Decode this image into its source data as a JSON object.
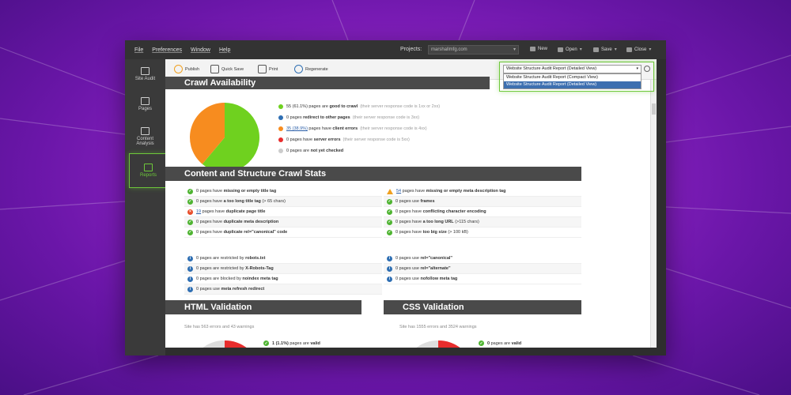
{
  "menu": {
    "items": [
      "File",
      "Preferences",
      "Window",
      "Help"
    ],
    "projects_label": "Projects:",
    "project_value": "marshallmfg.com",
    "new_label": "New",
    "open_label": "Open",
    "save_label": "Save",
    "close_label": "Close"
  },
  "sidebar": {
    "site_audit": "Site Audit",
    "pages": "Pages",
    "content_analysis_1": "Content",
    "content_analysis_2": "Analysis",
    "reports": "Reports"
  },
  "toolbar": {
    "publish": "Publish",
    "quick_save": "Quick Save",
    "print": "Print",
    "regenerate": "Regenerate",
    "report_select": "Website Structure Audit Report (Detailed View)",
    "dropdown_options": [
      "Website Structure Audit Report (Compact View)",
      "Website Structure Audit Report (Detailed View)"
    ]
  },
  "crawl": {
    "title": "Crawl Availability",
    "pie": {
      "good": 61.1,
      "client_errors": 38.9,
      "colors": {
        "good": "#6fd11f",
        "client_errors": "#f78c1f"
      }
    },
    "legend": [
      {
        "color": "#6fd11f",
        "count": "55 (61.1%)",
        "pre": "pages are",
        "bold": "good to crawl",
        "note": "(their server response code is 1xx or 2xx)"
      },
      {
        "color": "#2f6fb3",
        "count": "0",
        "pre": "pages",
        "bold": "redirect to other pages",
        "note": "(their server response code is 3xx)"
      },
      {
        "color": "#f78c1f",
        "count": "35 (38.9%)",
        "pre": "pages have",
        "bold": "client errors",
        "note": "(their server response code is 4xx)"
      },
      {
        "color": "#e82d2d",
        "count": "0",
        "pre": "pages have",
        "bold": "server errors",
        "note": "(their server response code is 5xx)"
      },
      {
        "color": "#cccccc",
        "count": "0",
        "pre": "pages are",
        "bold": "not yet checked",
        "note": ""
      }
    ]
  },
  "stats": {
    "title": "Content and Structure Crawl Stats",
    "left": [
      {
        "icon": "green",
        "count": "0",
        "pre": "pages have",
        "bold": "missing or empty title tag",
        "post": ""
      },
      {
        "icon": "green",
        "count": "0",
        "pre": "pages have",
        "bold": "a too long title tag",
        "post": "(> 65 chars)"
      },
      {
        "icon": "red",
        "count": "19",
        "pre": "pages have",
        "bold": "duplicate page title",
        "post": ""
      },
      {
        "icon": "green",
        "count": "0",
        "pre": "pages have",
        "bold": "duplicate meta description",
        "post": ""
      },
      {
        "icon": "green",
        "count": "0",
        "pre": "pages have",
        "bold": "duplicate rel=\"canonical\" code",
        "post": ""
      }
    ],
    "right": [
      {
        "icon": "warn",
        "count": "54",
        "pre": "pages have",
        "bold": "missing or empty meta description tag",
        "post": ""
      },
      {
        "icon": "green",
        "count": "0",
        "pre": "pages use",
        "bold": "frames",
        "post": ""
      },
      {
        "icon": "green",
        "count": "0",
        "pre": "pages have",
        "bold": "conflicting character encoding",
        "post": ""
      },
      {
        "icon": "green",
        "count": "0",
        "pre": "pages have",
        "bold": "a too long URL",
        "post": "(>115 chars)"
      },
      {
        "icon": "green",
        "count": "0",
        "pre": "pages have",
        "bold": "too big size",
        "post": "(> 100 kB)"
      }
    ],
    "left2": [
      {
        "icon": "blue",
        "count": "0",
        "pre": "pages are restricted by",
        "bold": "robots.txt",
        "post": ""
      },
      {
        "icon": "blue",
        "count": "0",
        "pre": "pages are restricted by",
        "bold": "X-Robots-Tag",
        "post": ""
      },
      {
        "icon": "blue",
        "count": "0",
        "pre": "pages are blocked by",
        "bold": "noindex meta tag",
        "post": ""
      },
      {
        "icon": "blue",
        "count": "0",
        "pre": "pages use",
        "bold": "meta refresh redirect",
        "post": ""
      }
    ],
    "right2": [
      {
        "icon": "blue",
        "count": "0",
        "pre": "pages use",
        "bold": "rel=\"canonical\"",
        "post": ""
      },
      {
        "icon": "blue",
        "count": "0",
        "pre": "pages use",
        "bold": "rel=\"alternate\"",
        "post": ""
      },
      {
        "icon": "blue",
        "count": "0",
        "pre": "pages use",
        "bold": "nofollow meta tag",
        "post": ""
      }
    ]
  },
  "html_validation": {
    "title": "HTML Validation",
    "summary": "Site has 563 errors and 43 warnings",
    "valid_count": "1 (1.1%)",
    "valid_pre": "pages are",
    "valid_bold": "valid"
  },
  "css_validation": {
    "title": "CSS Validation",
    "summary": "Site has 1555 errors and 3524 warnings",
    "valid_count": "0",
    "valid_pre": "pages are",
    "valid_bold": "valid"
  }
}
